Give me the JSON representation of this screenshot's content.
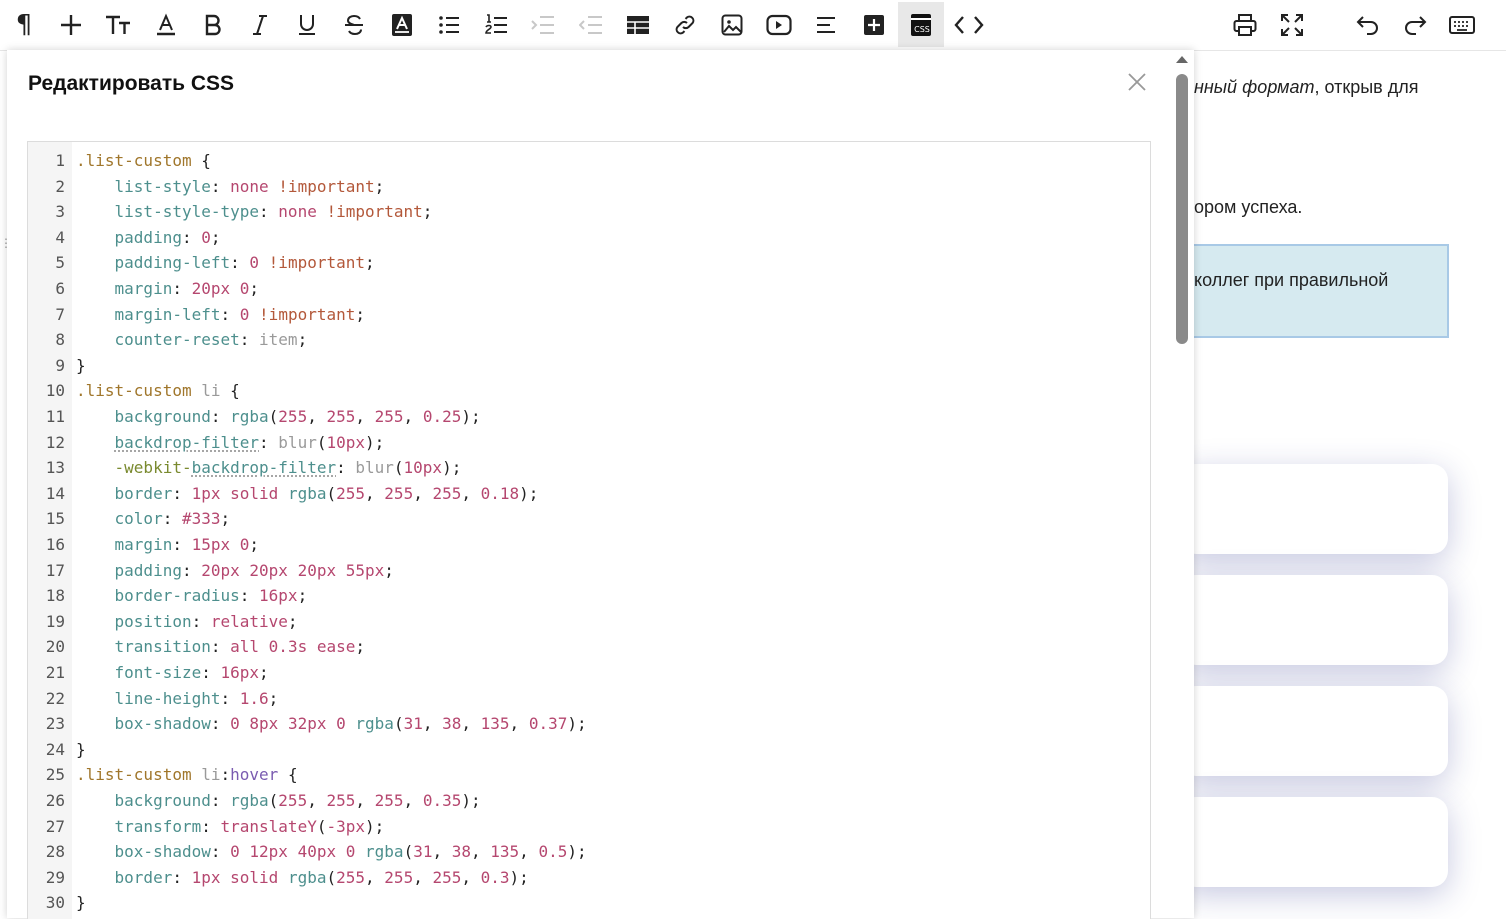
{
  "toolbar": {
    "items": [
      {
        "name": "paragraph-icon"
      },
      {
        "name": "insert-plus-icon"
      },
      {
        "name": "text-size-icon"
      },
      {
        "name": "font-color-icon"
      },
      {
        "name": "bold-icon"
      },
      {
        "name": "italic-icon"
      },
      {
        "name": "underline-icon"
      },
      {
        "name": "strikethrough-icon"
      },
      {
        "name": "highlight-icon"
      },
      {
        "name": "bullet-list-icon"
      },
      {
        "name": "numbered-list-icon"
      },
      {
        "name": "indent-icon"
      },
      {
        "name": "outdent-icon"
      },
      {
        "name": "table-icon"
      },
      {
        "name": "link-icon"
      },
      {
        "name": "image-icon"
      },
      {
        "name": "video-icon"
      },
      {
        "name": "align-icon"
      },
      {
        "name": "add-block-icon"
      },
      {
        "name": "css-icon"
      },
      {
        "name": "code-view-icon"
      },
      {
        "name": "print-icon"
      },
      {
        "name": "fullscreen-icon"
      },
      {
        "name": "undo-icon"
      },
      {
        "name": "redo-icon"
      },
      {
        "name": "keyboard-icon"
      }
    ],
    "css_button_label": "CSS",
    "active_item": "css-icon"
  },
  "modal": {
    "title": "Редактировать CSS",
    "code": [
      {
        "n": "1",
        "tokens": [
          [
            "sel",
            ".list-custom"
          ],
          [
            "p",
            " {"
          ]
        ]
      },
      {
        "n": "2",
        "tokens": [
          [
            "p",
            "    "
          ],
          [
            "prop",
            "list-style"
          ],
          [
            "p",
            ": "
          ],
          [
            "val",
            "none"
          ],
          [
            "p",
            " "
          ],
          [
            "kw",
            "!important"
          ],
          [
            "p",
            ";"
          ]
        ]
      },
      {
        "n": "3",
        "tokens": [
          [
            "p",
            "    "
          ],
          [
            "prop",
            "list-style-type"
          ],
          [
            "p",
            ": "
          ],
          [
            "val",
            "none"
          ],
          [
            "p",
            " "
          ],
          [
            "kw",
            "!important"
          ],
          [
            "p",
            ";"
          ]
        ]
      },
      {
        "n": "4",
        "tokens": [
          [
            "p",
            "    "
          ],
          [
            "prop",
            "padding"
          ],
          [
            "p",
            ": "
          ],
          [
            "num",
            "0"
          ],
          [
            "p",
            ";"
          ]
        ]
      },
      {
        "n": "5",
        "tokens": [
          [
            "p",
            "    "
          ],
          [
            "prop",
            "padding-left"
          ],
          [
            "p",
            ": "
          ],
          [
            "num",
            "0"
          ],
          [
            "p",
            " "
          ],
          [
            "kw",
            "!important"
          ],
          [
            "p",
            ";"
          ]
        ]
      },
      {
        "n": "6",
        "tokens": [
          [
            "p",
            "    "
          ],
          [
            "prop",
            "margin"
          ],
          [
            "p",
            ": "
          ],
          [
            "num",
            "20px"
          ],
          [
            "p",
            " "
          ],
          [
            "num",
            "0"
          ],
          [
            "p",
            ";"
          ]
        ]
      },
      {
        "n": "7",
        "tokens": [
          [
            "p",
            "    "
          ],
          [
            "prop",
            "margin-left"
          ],
          [
            "p",
            ": "
          ],
          [
            "num",
            "0"
          ],
          [
            "p",
            " "
          ],
          [
            "kw",
            "!important"
          ],
          [
            "p",
            ";"
          ]
        ]
      },
      {
        "n": "8",
        "tokens": [
          [
            "p",
            "    "
          ],
          [
            "prop",
            "counter-reset"
          ],
          [
            "p",
            ": "
          ],
          [
            "fnv",
            "item"
          ],
          [
            "p",
            ";"
          ]
        ]
      },
      {
        "n": "9",
        "tokens": [
          [
            "p",
            "}"
          ]
        ]
      },
      {
        "n": "10",
        "tokens": [
          [
            "sel",
            ".list-custom"
          ],
          [
            "p",
            " "
          ],
          [
            "tag",
            "li"
          ],
          [
            "p",
            " {"
          ]
        ]
      },
      {
        "n": "11",
        "tokens": [
          [
            "p",
            "    "
          ],
          [
            "prop",
            "background"
          ],
          [
            "p",
            ": "
          ],
          [
            "fn",
            "rgba"
          ],
          [
            "p",
            "("
          ],
          [
            "num",
            "255"
          ],
          [
            "p",
            ", "
          ],
          [
            "num",
            "255"
          ],
          [
            "p",
            ", "
          ],
          [
            "num",
            "255"
          ],
          [
            "p",
            ", "
          ],
          [
            "num",
            "0.25"
          ],
          [
            "p",
            ");"
          ]
        ]
      },
      {
        "n": "12",
        "tokens": [
          [
            "p",
            "    "
          ],
          [
            "propu",
            "backdrop-filter"
          ],
          [
            "p",
            ": "
          ],
          [
            "fnv",
            "blur"
          ],
          [
            "p",
            "("
          ],
          [
            "num",
            "10px"
          ],
          [
            "p",
            ");"
          ]
        ]
      },
      {
        "n": "13",
        "tokens": [
          [
            "p",
            "    "
          ],
          [
            "propv",
            "-webkit-"
          ],
          [
            "propu",
            "backdrop-filter"
          ],
          [
            "p",
            ": "
          ],
          [
            "fnv",
            "blur"
          ],
          [
            "p",
            "("
          ],
          [
            "num",
            "10px"
          ],
          [
            "p",
            ");"
          ]
        ]
      },
      {
        "n": "14",
        "tokens": [
          [
            "p",
            "    "
          ],
          [
            "prop",
            "border"
          ],
          [
            "p",
            ": "
          ],
          [
            "num",
            "1px"
          ],
          [
            "p",
            " "
          ],
          [
            "val",
            "solid"
          ],
          [
            "p",
            " "
          ],
          [
            "fn",
            "rgba"
          ],
          [
            "p",
            "("
          ],
          [
            "num",
            "255"
          ],
          [
            "p",
            ", "
          ],
          [
            "num",
            "255"
          ],
          [
            "p",
            ", "
          ],
          [
            "num",
            "255"
          ],
          [
            "p",
            ", "
          ],
          [
            "num",
            "0.18"
          ],
          [
            "p",
            ");"
          ]
        ]
      },
      {
        "n": "15",
        "tokens": [
          [
            "p",
            "    "
          ],
          [
            "prop",
            "color"
          ],
          [
            "p",
            ": "
          ],
          [
            "num",
            "#333"
          ],
          [
            "p",
            ";"
          ]
        ]
      },
      {
        "n": "16",
        "tokens": [
          [
            "p",
            "    "
          ],
          [
            "prop",
            "margin"
          ],
          [
            "p",
            ": "
          ],
          [
            "num",
            "15px"
          ],
          [
            "p",
            " "
          ],
          [
            "num",
            "0"
          ],
          [
            "p",
            ";"
          ]
        ]
      },
      {
        "n": "17",
        "tokens": [
          [
            "p",
            "    "
          ],
          [
            "prop",
            "padding"
          ],
          [
            "p",
            ": "
          ],
          [
            "num",
            "20px"
          ],
          [
            "p",
            " "
          ],
          [
            "num",
            "20px"
          ],
          [
            "p",
            " "
          ],
          [
            "num",
            "20px"
          ],
          [
            "p",
            " "
          ],
          [
            "num",
            "55px"
          ],
          [
            "p",
            ";"
          ]
        ]
      },
      {
        "n": "18",
        "tokens": [
          [
            "p",
            "    "
          ],
          [
            "prop",
            "border-radius"
          ],
          [
            "p",
            ": "
          ],
          [
            "num",
            "16px"
          ],
          [
            "p",
            ";"
          ]
        ]
      },
      {
        "n": "19",
        "tokens": [
          [
            "p",
            "    "
          ],
          [
            "prop",
            "position"
          ],
          [
            "p",
            ": "
          ],
          [
            "val",
            "relative"
          ],
          [
            "p",
            ";"
          ]
        ]
      },
      {
        "n": "20",
        "tokens": [
          [
            "p",
            "    "
          ],
          [
            "prop",
            "transition"
          ],
          [
            "p",
            ": "
          ],
          [
            "val",
            "all"
          ],
          [
            "p",
            " "
          ],
          [
            "num",
            "0.3s"
          ],
          [
            "p",
            " "
          ],
          [
            "val",
            "ease"
          ],
          [
            "p",
            ";"
          ]
        ]
      },
      {
        "n": "21",
        "tokens": [
          [
            "p",
            "    "
          ],
          [
            "prop",
            "font-size"
          ],
          [
            "p",
            ": "
          ],
          [
            "num",
            "16px"
          ],
          [
            "p",
            ";"
          ]
        ]
      },
      {
        "n": "22",
        "tokens": [
          [
            "p",
            "    "
          ],
          [
            "prop",
            "line-height"
          ],
          [
            "p",
            ": "
          ],
          [
            "num",
            "1.6"
          ],
          [
            "p",
            ";"
          ]
        ]
      },
      {
        "n": "23",
        "tokens": [
          [
            "p",
            "    "
          ],
          [
            "prop",
            "box-shadow"
          ],
          [
            "p",
            ": "
          ],
          [
            "num",
            "0"
          ],
          [
            "p",
            " "
          ],
          [
            "num",
            "8px"
          ],
          [
            "p",
            " "
          ],
          [
            "num",
            "32px"
          ],
          [
            "p",
            " "
          ],
          [
            "num",
            "0"
          ],
          [
            "p",
            " "
          ],
          [
            "fn",
            "rgba"
          ],
          [
            "p",
            "("
          ],
          [
            "num",
            "31"
          ],
          [
            "p",
            ", "
          ],
          [
            "num",
            "38"
          ],
          [
            "p",
            ", "
          ],
          [
            "num",
            "135"
          ],
          [
            "p",
            ", "
          ],
          [
            "num",
            "0.37"
          ],
          [
            "p",
            ");"
          ]
        ]
      },
      {
        "n": "24",
        "tokens": [
          [
            "p",
            "}"
          ]
        ]
      },
      {
        "n": "25",
        "tokens": [
          [
            "sel",
            ".list-custom"
          ],
          [
            "p",
            " "
          ],
          [
            "tag",
            "li"
          ],
          [
            "p",
            ":"
          ],
          [
            "pseudo",
            "hover"
          ],
          [
            "p",
            " {"
          ]
        ]
      },
      {
        "n": "26",
        "tokens": [
          [
            "p",
            "    "
          ],
          [
            "prop",
            "background"
          ],
          [
            "p",
            ": "
          ],
          [
            "fn",
            "rgba"
          ],
          [
            "p",
            "("
          ],
          [
            "num",
            "255"
          ],
          [
            "p",
            ", "
          ],
          [
            "num",
            "255"
          ],
          [
            "p",
            ", "
          ],
          [
            "num",
            "255"
          ],
          [
            "p",
            ", "
          ],
          [
            "num",
            "0.35"
          ],
          [
            "p",
            ");"
          ]
        ]
      },
      {
        "n": "27",
        "tokens": [
          [
            "p",
            "    "
          ],
          [
            "prop",
            "transform"
          ],
          [
            "p",
            ": "
          ],
          [
            "val",
            "translateY"
          ],
          [
            "p",
            "("
          ],
          [
            "num",
            "-3px"
          ],
          [
            "p",
            ");"
          ]
        ]
      },
      {
        "n": "28",
        "tokens": [
          [
            "p",
            "    "
          ],
          [
            "prop",
            "box-shadow"
          ],
          [
            "p",
            ": "
          ],
          [
            "num",
            "0"
          ],
          [
            "p",
            " "
          ],
          [
            "num",
            "12px"
          ],
          [
            "p",
            " "
          ],
          [
            "num",
            "40px"
          ],
          [
            "p",
            " "
          ],
          [
            "num",
            "0"
          ],
          [
            "p",
            " "
          ],
          [
            "fn",
            "rgba"
          ],
          [
            "p",
            "("
          ],
          [
            "num",
            "31"
          ],
          [
            "p",
            ", "
          ],
          [
            "num",
            "38"
          ],
          [
            "p",
            ", "
          ],
          [
            "num",
            "135"
          ],
          [
            "p",
            ", "
          ],
          [
            "num",
            "0.5"
          ],
          [
            "p",
            ");"
          ]
        ]
      },
      {
        "n": "29",
        "tokens": [
          [
            "p",
            "    "
          ],
          [
            "prop",
            "border"
          ],
          [
            "p",
            ": "
          ],
          [
            "num",
            "1px"
          ],
          [
            "p",
            " "
          ],
          [
            "val",
            "solid"
          ],
          [
            "p",
            " "
          ],
          [
            "fn",
            "rgba"
          ],
          [
            "p",
            "("
          ],
          [
            "num",
            "255"
          ],
          [
            "p",
            ", "
          ],
          [
            "num",
            "255"
          ],
          [
            "p",
            ", "
          ],
          [
            "num",
            "255"
          ],
          [
            "p",
            ", "
          ],
          [
            "num",
            "0.3"
          ],
          [
            "p",
            ");"
          ]
        ]
      },
      {
        "n": "30",
        "tokens": [
          [
            "p",
            "}"
          ]
        ]
      }
    ]
  },
  "background_doc": {
    "line1_italic": "нный формат",
    "line1_rest": ", открыв для",
    "line2": "ором успеха.",
    "callout_text": "коллег при правильной"
  },
  "colors": {
    "accent_arrow": "#e02020",
    "callout_bg": "#d6eaf0",
    "callout_border": "#a8c9e6"
  }
}
